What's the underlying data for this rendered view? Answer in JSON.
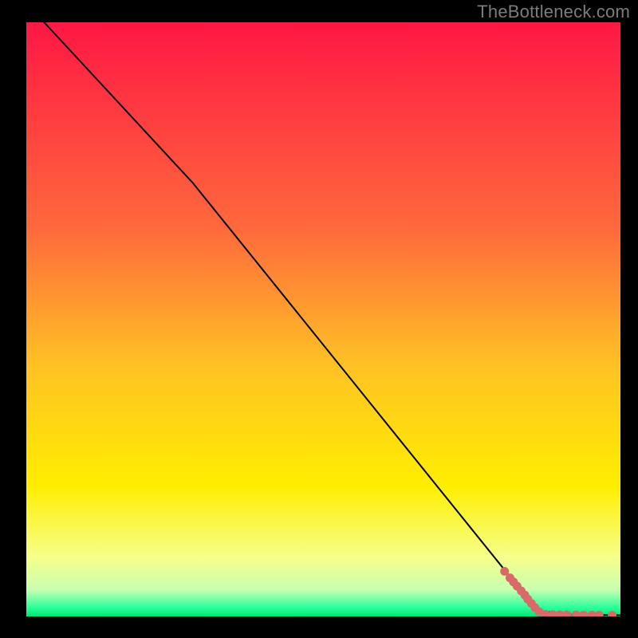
{
  "watermark": "TheBottleneck.com",
  "chart_data": {
    "type": "line",
    "title": "",
    "xlabel": "",
    "ylabel": "",
    "xlim": [
      0,
      100
    ],
    "ylim": [
      0,
      100
    ],
    "grid": false,
    "legend": false,
    "background_gradient_stops": [
      {
        "offset": 0.0,
        "color": "#ff1744"
      },
      {
        "offset": 0.35,
        "color": "#ff6a3c"
      },
      {
        "offset": 0.58,
        "color": "#ffc224"
      },
      {
        "offset": 0.78,
        "color": "#ffee00"
      },
      {
        "offset": 0.9,
        "color": "#f6ff8a"
      },
      {
        "offset": 0.955,
        "color": "#c8ffb0"
      },
      {
        "offset": 0.985,
        "color": "#2bff9a"
      },
      {
        "offset": 1.0,
        "color": "#00e676"
      }
    ],
    "series": [
      {
        "name": "curve",
        "color": "#000000",
        "points": [
          {
            "x": 3.0,
            "y": 100.0
          },
          {
            "x": 28.0,
            "y": 73.0
          },
          {
            "x": 86.0,
            "y": 1.0
          },
          {
            "x": 91.0,
            "y": 0.3
          },
          {
            "x": 100.0,
            "y": 0.2
          }
        ]
      }
    ],
    "scatter": {
      "name": "dots",
      "color": "#d86a6a",
      "radius": 5.5,
      "points": [
        {
          "x": 80.5,
          "y": 7.6
        },
        {
          "x": 81.4,
          "y": 6.5
        },
        {
          "x": 82.0,
          "y": 5.8
        },
        {
          "x": 82.6,
          "y": 5.1
        },
        {
          "x": 83.3,
          "y": 4.3
        },
        {
          "x": 83.9,
          "y": 3.6
        },
        {
          "x": 84.4,
          "y": 2.9
        },
        {
          "x": 85.0,
          "y": 2.2
        },
        {
          "x": 85.6,
          "y": 1.5
        },
        {
          "x": 86.3,
          "y": 0.8
        },
        {
          "x": 87.4,
          "y": 0.35
        },
        {
          "x": 88.6,
          "y": 0.3
        },
        {
          "x": 89.8,
          "y": 0.28
        },
        {
          "x": 91.0,
          "y": 0.26
        },
        {
          "x": 92.5,
          "y": 0.24
        },
        {
          "x": 93.8,
          "y": 0.22
        },
        {
          "x": 95.2,
          "y": 0.21
        },
        {
          "x": 96.4,
          "y": 0.2
        },
        {
          "x": 98.6,
          "y": 0.19
        }
      ]
    }
  }
}
